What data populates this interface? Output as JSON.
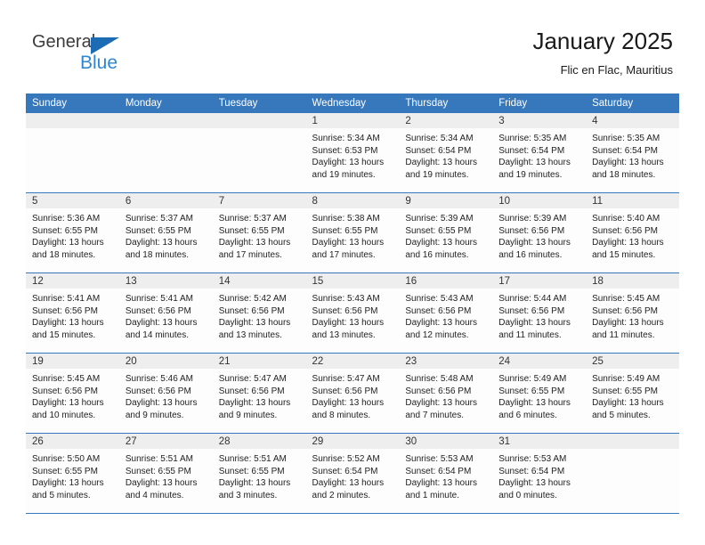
{
  "brand": {
    "name_top": "General",
    "name_bottom": "Blue",
    "triangle_color": "#1b6cb4",
    "blue_color": "#2e86d4"
  },
  "header": {
    "title": "January 2025",
    "subtitle": "Flic en Flac, Mauritius"
  },
  "theme": {
    "header_row_bg": "#3778bd",
    "daynum_bg": "#eeeeee",
    "cell_bg": "#fdfdfd",
    "row_border": "#3778bd"
  },
  "weekdays": [
    "Sunday",
    "Monday",
    "Tuesday",
    "Wednesday",
    "Thursday",
    "Friday",
    "Saturday"
  ],
  "labels": {
    "sunrise": "Sunrise:",
    "sunset": "Sunset:",
    "daylight": "Daylight:"
  },
  "weeks": [
    [
      {
        "day": "",
        "empty": true
      },
      {
        "day": "",
        "empty": true
      },
      {
        "day": "",
        "empty": true
      },
      {
        "day": "1",
        "sunrise": "Sunrise: 5:34 AM",
        "sunset": "Sunset: 6:53 PM",
        "daylight": "Daylight: 13 hours and 19 minutes."
      },
      {
        "day": "2",
        "sunrise": "Sunrise: 5:34 AM",
        "sunset": "Sunset: 6:54 PM",
        "daylight": "Daylight: 13 hours and 19 minutes."
      },
      {
        "day": "3",
        "sunrise": "Sunrise: 5:35 AM",
        "sunset": "Sunset: 6:54 PM",
        "daylight": "Daylight: 13 hours and 19 minutes."
      },
      {
        "day": "4",
        "sunrise": "Sunrise: 5:35 AM",
        "sunset": "Sunset: 6:54 PM",
        "daylight": "Daylight: 13 hours and 18 minutes."
      }
    ],
    [
      {
        "day": "5",
        "sunrise": "Sunrise: 5:36 AM",
        "sunset": "Sunset: 6:55 PM",
        "daylight": "Daylight: 13 hours and 18 minutes."
      },
      {
        "day": "6",
        "sunrise": "Sunrise: 5:37 AM",
        "sunset": "Sunset: 6:55 PM",
        "daylight": "Daylight: 13 hours and 18 minutes."
      },
      {
        "day": "7",
        "sunrise": "Sunrise: 5:37 AM",
        "sunset": "Sunset: 6:55 PM",
        "daylight": "Daylight: 13 hours and 17 minutes."
      },
      {
        "day": "8",
        "sunrise": "Sunrise: 5:38 AM",
        "sunset": "Sunset: 6:55 PM",
        "daylight": "Daylight: 13 hours and 17 minutes."
      },
      {
        "day": "9",
        "sunrise": "Sunrise: 5:39 AM",
        "sunset": "Sunset: 6:55 PM",
        "daylight": "Daylight: 13 hours and 16 minutes."
      },
      {
        "day": "10",
        "sunrise": "Sunrise: 5:39 AM",
        "sunset": "Sunset: 6:56 PM",
        "daylight": "Daylight: 13 hours and 16 minutes."
      },
      {
        "day": "11",
        "sunrise": "Sunrise: 5:40 AM",
        "sunset": "Sunset: 6:56 PM",
        "daylight": "Daylight: 13 hours and 15 minutes."
      }
    ],
    [
      {
        "day": "12",
        "sunrise": "Sunrise: 5:41 AM",
        "sunset": "Sunset: 6:56 PM",
        "daylight": "Daylight: 13 hours and 15 minutes."
      },
      {
        "day": "13",
        "sunrise": "Sunrise: 5:41 AM",
        "sunset": "Sunset: 6:56 PM",
        "daylight": "Daylight: 13 hours and 14 minutes."
      },
      {
        "day": "14",
        "sunrise": "Sunrise: 5:42 AM",
        "sunset": "Sunset: 6:56 PM",
        "daylight": "Daylight: 13 hours and 13 minutes."
      },
      {
        "day": "15",
        "sunrise": "Sunrise: 5:43 AM",
        "sunset": "Sunset: 6:56 PM",
        "daylight": "Daylight: 13 hours and 13 minutes."
      },
      {
        "day": "16",
        "sunrise": "Sunrise: 5:43 AM",
        "sunset": "Sunset: 6:56 PM",
        "daylight": "Daylight: 13 hours and 12 minutes."
      },
      {
        "day": "17",
        "sunrise": "Sunrise: 5:44 AM",
        "sunset": "Sunset: 6:56 PM",
        "daylight": "Daylight: 13 hours and 11 minutes."
      },
      {
        "day": "18",
        "sunrise": "Sunrise: 5:45 AM",
        "sunset": "Sunset: 6:56 PM",
        "daylight": "Daylight: 13 hours and 11 minutes."
      }
    ],
    [
      {
        "day": "19",
        "sunrise": "Sunrise: 5:45 AM",
        "sunset": "Sunset: 6:56 PM",
        "daylight": "Daylight: 13 hours and 10 minutes."
      },
      {
        "day": "20",
        "sunrise": "Sunrise: 5:46 AM",
        "sunset": "Sunset: 6:56 PM",
        "daylight": "Daylight: 13 hours and 9 minutes."
      },
      {
        "day": "21",
        "sunrise": "Sunrise: 5:47 AM",
        "sunset": "Sunset: 6:56 PM",
        "daylight": "Daylight: 13 hours and 9 minutes."
      },
      {
        "day": "22",
        "sunrise": "Sunrise: 5:47 AM",
        "sunset": "Sunset: 6:56 PM",
        "daylight": "Daylight: 13 hours and 8 minutes."
      },
      {
        "day": "23",
        "sunrise": "Sunrise: 5:48 AM",
        "sunset": "Sunset: 6:56 PM",
        "daylight": "Daylight: 13 hours and 7 minutes."
      },
      {
        "day": "24",
        "sunrise": "Sunrise: 5:49 AM",
        "sunset": "Sunset: 6:55 PM",
        "daylight": "Daylight: 13 hours and 6 minutes."
      },
      {
        "day": "25",
        "sunrise": "Sunrise: 5:49 AM",
        "sunset": "Sunset: 6:55 PM",
        "daylight": "Daylight: 13 hours and 5 minutes."
      }
    ],
    [
      {
        "day": "26",
        "sunrise": "Sunrise: 5:50 AM",
        "sunset": "Sunset: 6:55 PM",
        "daylight": "Daylight: 13 hours and 5 minutes."
      },
      {
        "day": "27",
        "sunrise": "Sunrise: 5:51 AM",
        "sunset": "Sunset: 6:55 PM",
        "daylight": "Daylight: 13 hours and 4 minutes."
      },
      {
        "day": "28",
        "sunrise": "Sunrise: 5:51 AM",
        "sunset": "Sunset: 6:55 PM",
        "daylight": "Daylight: 13 hours and 3 minutes."
      },
      {
        "day": "29",
        "sunrise": "Sunrise: 5:52 AM",
        "sunset": "Sunset: 6:54 PM",
        "daylight": "Daylight: 13 hours and 2 minutes."
      },
      {
        "day": "30",
        "sunrise": "Sunrise: 5:53 AM",
        "sunset": "Sunset: 6:54 PM",
        "daylight": "Daylight: 13 hours and 1 minute."
      },
      {
        "day": "31",
        "sunrise": "Sunrise: 5:53 AM",
        "sunset": "Sunset: 6:54 PM",
        "daylight": "Daylight: 13 hours and 0 minutes."
      },
      {
        "day": "",
        "empty": true
      }
    ]
  ]
}
